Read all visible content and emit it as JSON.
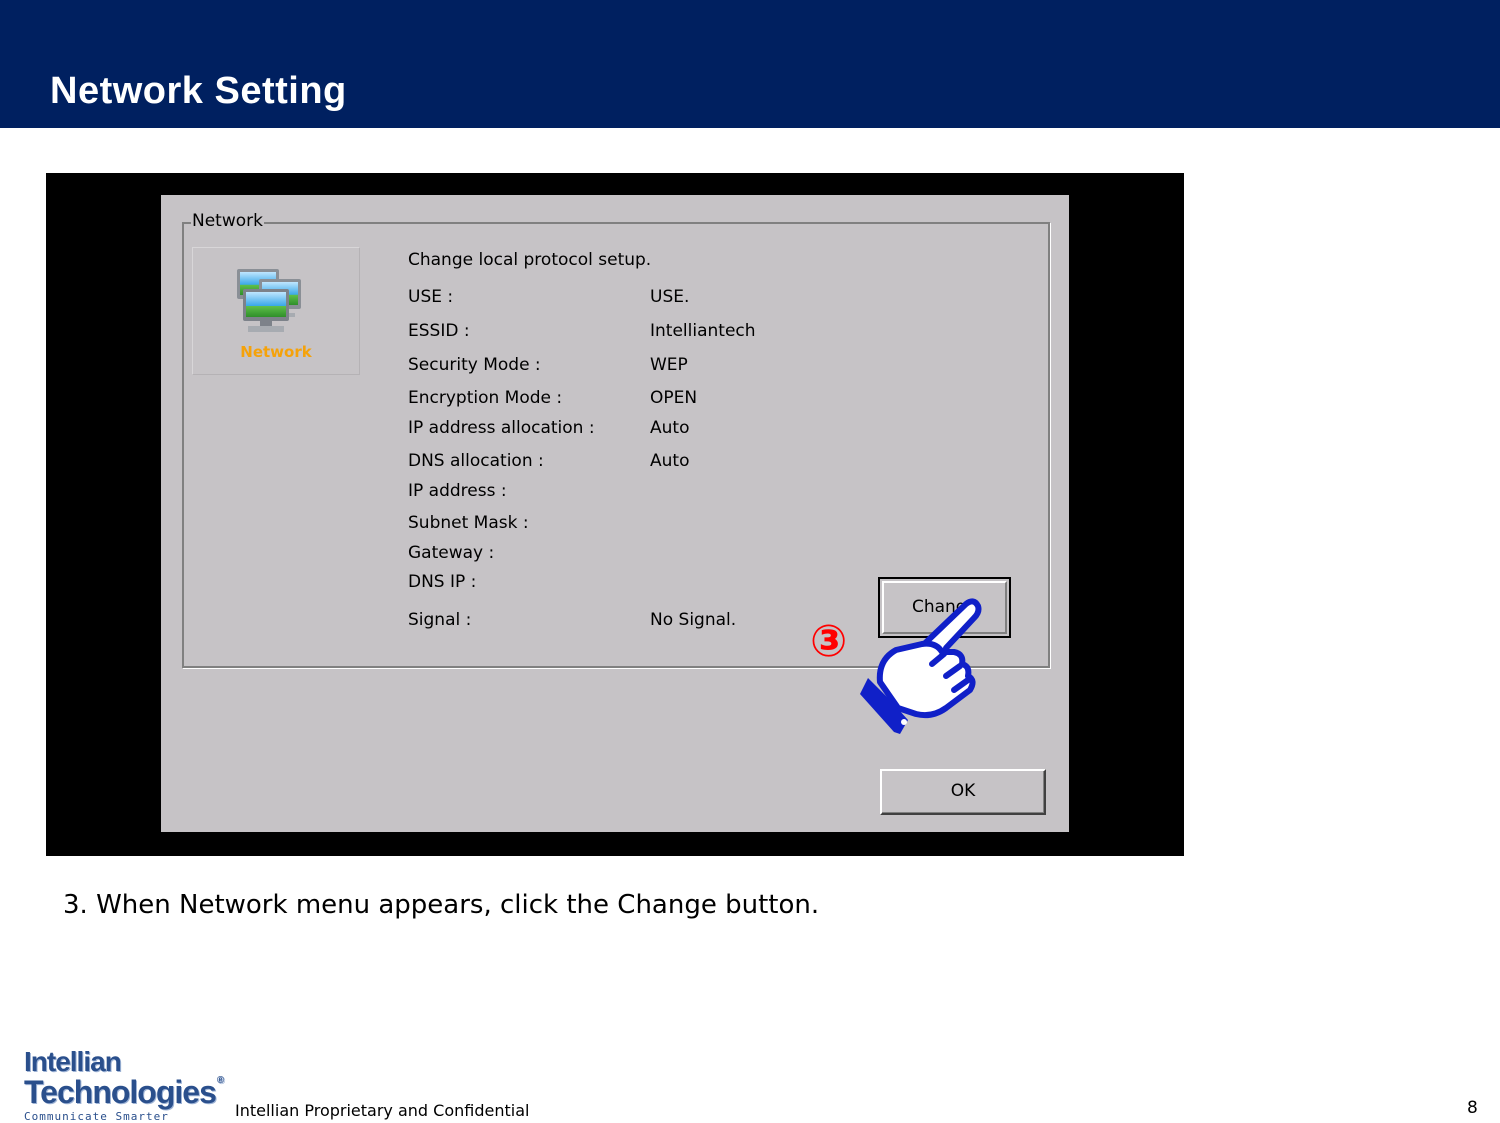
{
  "header": {
    "title": "Network Setting"
  },
  "dialog": {
    "group_title": "Network",
    "icon_label": "Network",
    "intro": "Change local protocol setup.",
    "rows": [
      {
        "label": "USE :",
        "value": "USE."
      },
      {
        "label": "ESSID :",
        "value": "Intelliantech"
      },
      {
        "label": "Security Mode :",
        "value": "WEP"
      },
      {
        "label": "Encryption Mode :",
        "value": "OPEN"
      },
      {
        "label": "IP address allocation :",
        "value": "Auto"
      },
      {
        "label": "DNS allocation :",
        "value": "Auto"
      },
      {
        "label": "IP address :",
        "value": ""
      },
      {
        "label": "Subnet Mask :",
        "value": ""
      },
      {
        "label": "Gateway :",
        "value": ""
      },
      {
        "label": "DNS IP :",
        "value": ""
      },
      {
        "label": "Signal :",
        "value": "No Signal."
      }
    ],
    "change_button": "Change",
    "ok_button": "OK"
  },
  "annotation": {
    "step": "③",
    "pointer_icon": "pointing-hand-icon"
  },
  "caption": "3. When Network menu appears, click the Change button.",
  "footer": {
    "logo_line1": "Intellian",
    "logo_line2": "Technologies",
    "logo_mark": "®",
    "logo_tagline": "Communicate Smarter",
    "text": "Intellian Proprietary and Confidential",
    "page": "8"
  },
  "colors": {
    "header_bg": "#002060",
    "dialog_bg": "#c6c3c6",
    "step_color": "#ff0000",
    "hand_color": "#1020c8",
    "icon_label_color": "#f5a20a"
  }
}
